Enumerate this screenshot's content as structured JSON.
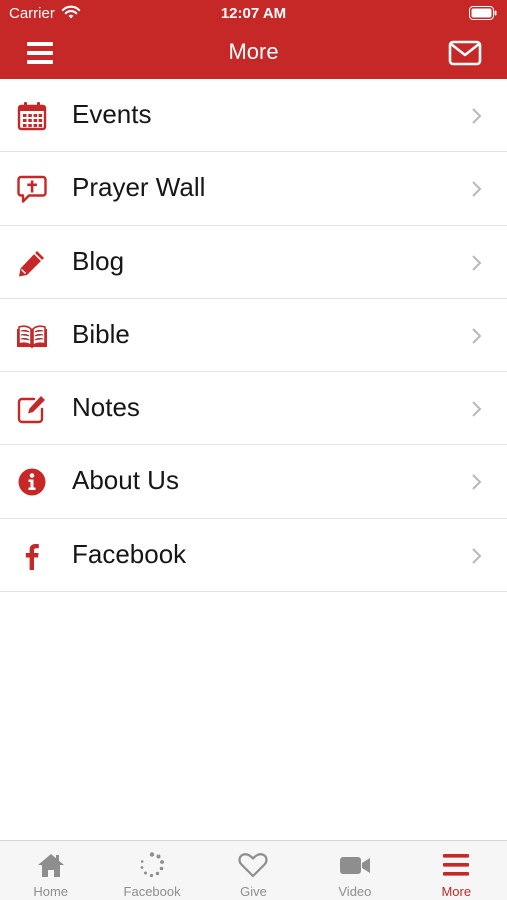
{
  "status_bar": {
    "carrier": "Carrier",
    "time": "12:07 AM"
  },
  "header": {
    "title": "More",
    "left_icon": "hamburger-menu-icon",
    "right_icon": "envelope-icon",
    "background_color": "#c62828"
  },
  "menu": {
    "items": [
      {
        "label": "Events",
        "icon": "calendar-icon"
      },
      {
        "label": "Prayer Wall",
        "icon": "prayer-bubble-icon"
      },
      {
        "label": "Blog",
        "icon": "pencil-icon"
      },
      {
        "label": "Bible",
        "icon": "open-book-icon"
      },
      {
        "label": "Notes",
        "icon": "edit-note-icon"
      },
      {
        "label": "About Us",
        "icon": "info-icon"
      },
      {
        "label": "Facebook",
        "icon": "facebook-icon"
      }
    ],
    "accent_color": "#c62828"
  },
  "tabs": [
    {
      "label": "Home",
      "icon": "home-icon",
      "active": false
    },
    {
      "label": "Facebook",
      "icon": "refresh-icon",
      "active": false
    },
    {
      "label": "Give",
      "icon": "heart-icon",
      "active": false
    },
    {
      "label": "Video",
      "icon": "video-camera-icon",
      "active": false
    },
    {
      "label": "More",
      "icon": "hamburger-menu-icon",
      "active": true
    }
  ]
}
